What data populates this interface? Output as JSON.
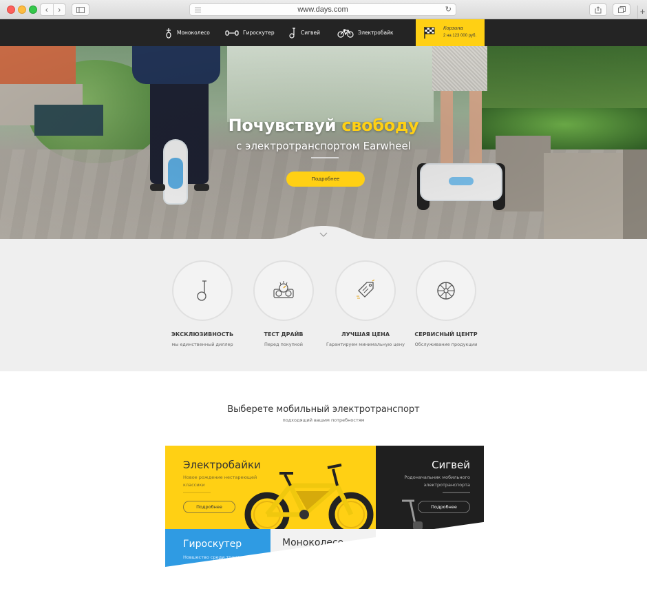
{
  "browser": {
    "url": "www.days.com",
    "back_icon": "chevron-left-icon",
    "forward_icon": "chevron-right-icon"
  },
  "nav": {
    "items": [
      {
        "label": "Моноколесо",
        "icon": "monowheel-icon"
      },
      {
        "label": "Гироскутер",
        "icon": "hoverboard-icon"
      },
      {
        "label": "Сигвей",
        "icon": "segway-icon"
      },
      {
        "label": "Электробайк",
        "icon": "bicycle-icon"
      }
    ],
    "cart": {
      "title": "Корзина",
      "count_prefix": "2",
      "count_unit": "на",
      "total": "123 000 руб."
    }
  },
  "hero": {
    "title_part1": "Почувствуй",
    "title_accent": "свободу",
    "subtitle": "с электротранспортом Earwheel",
    "button": "Подробнее"
  },
  "features": [
    {
      "title": "ЭКСКЛЮЗИВНОСТЬ",
      "desc": "мы единственный диллер",
      "icon": "monowheel-icon"
    },
    {
      "title": "ТЕСТ ДРАЙВ",
      "desc": "Перед покупкой",
      "icon": "speedometer-icon"
    },
    {
      "title": "ЛУЧШАЯ ЦЕНА",
      "desc": "Гарантируем минимальную цену",
      "icon": "price-tag-icon"
    },
    {
      "title": "СЕРВИСНЫЙ ЦЕНТР",
      "desc": "Обслуживание продукции",
      "icon": "wheel-icon"
    }
  ],
  "products": {
    "title": "Выберете мобильный электротранспорт",
    "subtitle": "подходящий вашим потребностям",
    "ebike": {
      "name": "Электробайки",
      "desc": "Новое рождение нестареющей классики",
      "button": "Подробнее"
    },
    "segway": {
      "name": "Сигвей",
      "desc": "Родоначальник мобильного электротранспорта",
      "button": "Подробнее"
    },
    "gyro": {
      "name": "Гироскутер",
      "desc": "Новшество среди транспорта"
    },
    "mono": {
      "name": "Моноколесо"
    }
  },
  "colors": {
    "accent": "#ffd014",
    "nav_bg": "#242424",
    "gyro_tile": "#2f9be3",
    "segway_tile": "#1f1f1f"
  }
}
